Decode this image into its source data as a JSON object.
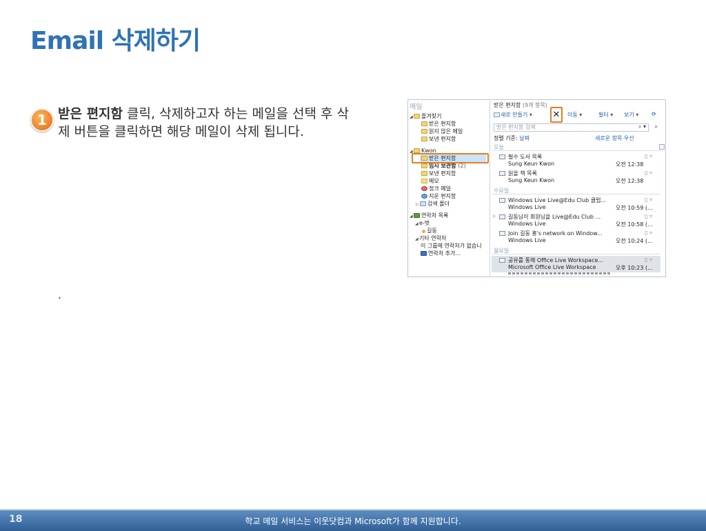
{
  "slide": {
    "title": "Email 삭제하기",
    "step_number": "1",
    "step_bold": "받은 편지함",
    "step_text": " 클릭, 삭제하고자 하는 메일을 선택 후 삭제 버튼을 클릭하면 해당 메일이 삭제 됩니다.",
    "extra_text": ".",
    "page_number": "18",
    "footer_text": "학교 메일 서비스는 이웃닷컴과 Microsoft가 함께 지원합니다."
  },
  "left_pane": {
    "header": "메일",
    "items": [
      {
        "label": "즐겨찾기",
        "icon": "star-folder-icon",
        "toggle": "◢"
      },
      {
        "label": "받은 편지함",
        "icon": "inbox-folder-icon"
      },
      {
        "label": "읽지 않은 메일",
        "icon": "unread-folder-icon"
      },
      {
        "label": "보낸 편지함",
        "icon": "sent-folder-icon"
      },
      {
        "label": "Kwon",
        "icon": "account-folder-icon",
        "toggle": "◢"
      },
      {
        "label": "받은 편지함",
        "icon": "inbox-folder-icon"
      },
      {
        "label": "임시 보관함",
        "count": "(2)",
        "icon": "drafts-folder-icon"
      },
      {
        "label": "보낸 편지함",
        "icon": "sent-folder-icon"
      },
      {
        "label": "메모",
        "icon": "note-icon"
      },
      {
        "label": "정크 메일",
        "icon": "junk-icon"
      },
      {
        "label": "지운 편지함",
        "icon": "deleted-icon"
      },
      {
        "label": "검색 폴더",
        "icon": "search-folder-icon",
        "toggle": "▷"
      },
      {
        "label": "연락처 목록",
        "icon": "contacts-icon",
        "toggle": "◢"
      },
      {
        "label": "e-벗",
        "toggle": "◢"
      },
      {
        "label": "길동",
        "icon": "contact-status-icon"
      },
      {
        "label": "기타 연락처",
        "toggle": "◢"
      },
      {
        "label": "이 그룹에 연락처가 없습니"
      },
      {
        "label": "연락처 추가...",
        "icon": "add-contact-icon"
      }
    ]
  },
  "right_pane": {
    "title": "받은 편지함",
    "count": "(9개 항목)",
    "toolbar": {
      "new": "새로 만들기",
      "delete": "✕",
      "move": "이동",
      "filter": "필터",
      "view": "보기",
      "dropdown": "▾"
    },
    "search_placeholder": "받은 편지함 검색",
    "sort_label": "정렬 기준:",
    "sort_value": "날짜",
    "sort_order": "새로운 항목 우선",
    "groups": [
      {
        "label": "오늘",
        "messages": [
          {
            "subject": "필수 도서 목록",
            "from": "Sung Keun Kwon",
            "time": "오전 12:38"
          },
          {
            "subject": "읽을 책 목록",
            "from": "Sung Keun Kwon",
            "time": "오전 12:38"
          }
        ]
      },
      {
        "label": "수요일",
        "messages": [
          {
            "subject": "Windows Live Live@Edu Club 클럽...",
            "from": "Windows Live",
            "time": "오전 10:59 (..."
          },
          {
            "subject": "길동님이 회원님을 Live@Edu Club ...",
            "from": "Windows Live",
            "time": "오전 10:58 (..."
          },
          {
            "subject": "Join 길동 홍's network on Window...",
            "from": "Windows Live",
            "time": "오전 10:24 (..."
          }
        ]
      },
      {
        "label": "월요일",
        "messages": [
          {
            "subject": "공유를 통해 Office Live Workspace...",
            "from": "Microsoft Office Live Workspace",
            "time": "오후 10:23 (..."
          }
        ]
      }
    ]
  }
}
